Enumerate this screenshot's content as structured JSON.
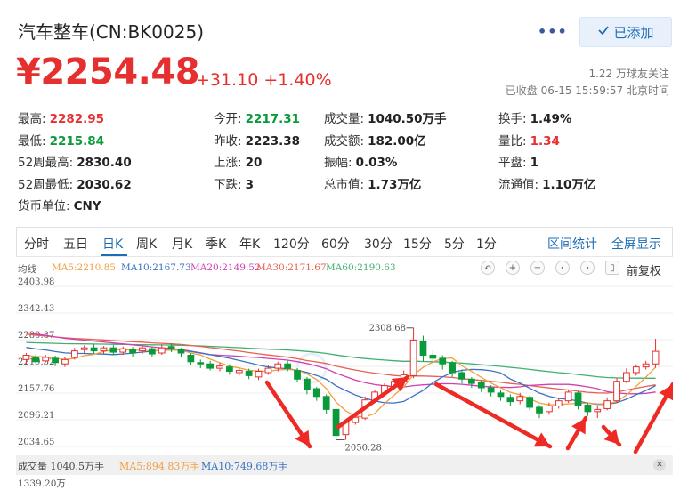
{
  "header": {
    "title": "汽车整车(CN:BK0025)",
    "more": "•••",
    "follow_label": "已添加",
    "price": "¥2254.48",
    "change": "+31.10 +1.40%",
    "followers": "1.22 万球友关注",
    "status": "已收盘 06-15 15:59:57 北京时间"
  },
  "stats": [
    {
      "label": "最高:",
      "value": "2282.95",
      "color": "red"
    },
    {
      "label": "今开:",
      "value": "2217.31",
      "color": "green"
    },
    {
      "label": "成交量:",
      "value": "1040.50万手",
      "color": ""
    },
    {
      "label": "换手:",
      "value": "1.49%",
      "color": ""
    },
    {
      "label": "最低:",
      "value": "2215.84",
      "color": "green"
    },
    {
      "label": "昨收:",
      "value": "2223.38",
      "color": ""
    },
    {
      "label": "成交额:",
      "value": "182.00亿",
      "color": ""
    },
    {
      "label": "量比:",
      "value": "1.34",
      "color": "red"
    },
    {
      "label": "52周最高:",
      "value": "2830.40",
      "color": ""
    },
    {
      "label": "上涨:",
      "value": "20",
      "color": ""
    },
    {
      "label": "振幅:",
      "value": "0.03%",
      "color": ""
    },
    {
      "label": "平盘:",
      "value": "1",
      "color": ""
    },
    {
      "label": "52周最低:",
      "value": "2030.62",
      "color": ""
    },
    {
      "label": "下跌:",
      "value": "3",
      "color": ""
    },
    {
      "label": "总市值:",
      "value": "1.73万亿",
      "color": ""
    },
    {
      "label": "流通值:",
      "value": "1.10万亿",
      "color": ""
    },
    {
      "label": "货币单位:",
      "value": "CNY",
      "color": ""
    }
  ],
  "tabs": [
    "分时",
    "五日",
    "日K",
    "周K",
    "月K",
    "季K",
    "年K",
    "120分",
    "60分",
    "30分",
    "15分",
    "5分",
    "1分"
  ],
  "tab_links": [
    "区间统计",
    "全屏显示"
  ],
  "ma": {
    "label": "均线",
    "ma5": "MA5:2210.85",
    "ma10": "MA10:2167.73",
    "ma20": "MA20:2149.52",
    "ma30": "MA30:2171.67",
    "ma60": "MA60:2190.63",
    "fq": "前复权",
    "colors": {
      "ma5": "#f0a040",
      "ma10": "#3a72c0",
      "ma20": "#d040b0",
      "ma30": "#e86050",
      "ma60": "#40b070"
    }
  },
  "y_axis": [
    "2403.98",
    "2342.43",
    "2280.87",
    "2219.32",
    "2157.76",
    "2096.21",
    "2034.65"
  ],
  "annotations": {
    "high": "2308.68",
    "low": "2050.28"
  },
  "volume": {
    "label": "成交量 1040.5万手",
    "ma5": "MA5:894.83万手",
    "ma10": "MA10:749.68万手",
    "axis": "1339.20万"
  },
  "chart_data": {
    "type": "candlestick",
    "ylim": [
      2034.65,
      2403.98
    ],
    "candles": [
      [
        2235,
        2245,
        2225,
        2250
      ],
      [
        2240,
        2230,
        2222,
        2248
      ],
      [
        2232,
        2240,
        2228,
        2246
      ],
      [
        2238,
        2228,
        2220,
        2244
      ],
      [
        2225,
        2235,
        2218,
        2240
      ],
      [
        2240,
        2255,
        2235,
        2262
      ],
      [
        2258,
        2262,
        2250,
        2268
      ],
      [
        2262,
        2255,
        2248,
        2270
      ],
      [
        2255,
        2262,
        2248,
        2266
      ],
      [
        2262,
        2252,
        2245,
        2268
      ],
      [
        2252,
        2260,
        2246,
        2265
      ],
      [
        2258,
        2250,
        2242,
        2264
      ],
      [
        2255,
        2262,
        2248,
        2268
      ],
      [
        2260,
        2248,
        2240,
        2264
      ],
      [
        2250,
        2262,
        2246,
        2270
      ],
      [
        2265,
        2260,
        2252,
        2272
      ],
      [
        2258,
        2250,
        2242,
        2262
      ],
      [
        2245,
        2230,
        2222,
        2250
      ],
      [
        2228,
        2225,
        2215,
        2235
      ],
      [
        2225,
        2215,
        2210,
        2232
      ],
      [
        2215,
        2220,
        2208,
        2228
      ],
      [
        2218,
        2208,
        2200,
        2224
      ],
      [
        2205,
        2210,
        2198,
        2216
      ],
      [
        2208,
        2198,
        2190,
        2214
      ],
      [
        2195,
        2208,
        2188,
        2214
      ],
      [
        2205,
        2215,
        2200,
        2222
      ],
      [
        2215,
        2225,
        2208,
        2230
      ],
      [
        2225,
        2215,
        2208,
        2232
      ],
      [
        2210,
        2190,
        2182,
        2215
      ],
      [
        2190,
        2165,
        2155,
        2195
      ],
      [
        2168,
        2150,
        2140,
        2172
      ],
      [
        2150,
        2120,
        2110,
        2155
      ],
      [
        2120,
        2060,
        2050,
        2125
      ],
      [
        2062,
        2090,
        2050,
        2095
      ],
      [
        2090,
        2102,
        2085,
        2108
      ],
      [
        2100,
        2142,
        2096,
        2150
      ],
      [
        2140,
        2160,
        2135,
        2166
      ],
      [
        2158,
        2175,
        2150,
        2180
      ],
      [
        2172,
        2185,
        2165,
        2190
      ],
      [
        2185,
        2200,
        2178,
        2210
      ],
      [
        2198,
        2280,
        2192,
        2308
      ],
      [
        2278,
        2245,
        2230,
        2290
      ],
      [
        2245,
        2238,
        2225,
        2255
      ],
      [
        2238,
        2225,
        2212,
        2245
      ],
      [
        2228,
        2205,
        2195,
        2232
      ],
      [
        2205,
        2190,
        2180,
        2212
      ],
      [
        2190,
        2180,
        2170,
        2195
      ],
      [
        2182,
        2170,
        2160,
        2188
      ],
      [
        2170,
        2160,
        2150,
        2176
      ],
      [
        2158,
        2150,
        2140,
        2165
      ],
      [
        2148,
        2138,
        2128,
        2155
      ],
      [
        2140,
        2150,
        2132,
        2158
      ],
      [
        2148,
        2125,
        2118,
        2152
      ],
      [
        2125,
        2112,
        2100,
        2130
      ],
      [
        2115,
        2128,
        2108,
        2136
      ],
      [
        2128,
        2140,
        2122,
        2146
      ],
      [
        2140,
        2160,
        2135,
        2166
      ],
      [
        2158,
        2130,
        2120,
        2162
      ],
      [
        2130,
        2115,
        2105,
        2135
      ],
      [
        2115,
        2120,
        2100,
        2128
      ],
      [
        2122,
        2140,
        2118,
        2148
      ],
      [
        2140,
        2185,
        2136,
        2192
      ],
      [
        2185,
        2205,
        2180,
        2215
      ],
      [
        2205,
        2218,
        2198,
        2224
      ],
      [
        2218,
        2225,
        2212,
        2232
      ],
      [
        2225,
        2254,
        2216,
        2283
      ]
    ]
  }
}
